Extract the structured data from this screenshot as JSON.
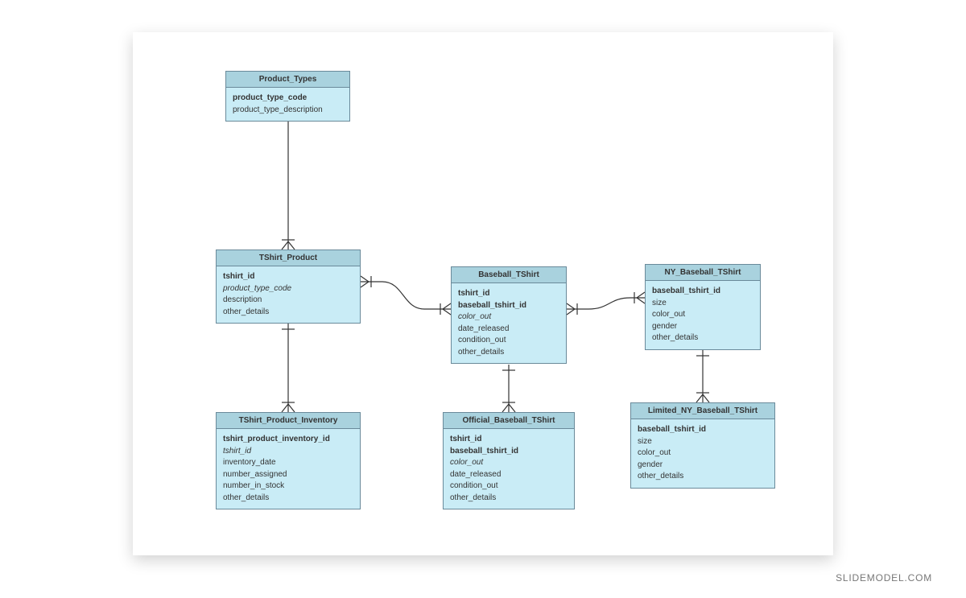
{
  "footer": "SLIDEMODEL.COM",
  "entities": {
    "product_types": {
      "title": "Product_Types",
      "attrs": [
        {
          "text": "product_type_code",
          "style": "bold"
        },
        {
          "text": "product_type_description",
          "style": ""
        }
      ]
    },
    "tshirt_product": {
      "title": "TShirt_Product",
      "attrs": [
        {
          "text": "tshirt_id",
          "style": "bold"
        },
        {
          "text": "product_type_code",
          "style": "italic"
        },
        {
          "text": "description",
          "style": ""
        },
        {
          "text": "other_details",
          "style": ""
        }
      ]
    },
    "tshirt_product_inventory": {
      "title": "TShirt_Product_Inventory",
      "attrs": [
        {
          "text": "tshirt_product_inventory_id",
          "style": "bold"
        },
        {
          "text": "tshirt_id",
          "style": "italic"
        },
        {
          "text": "inventory_date",
          "style": ""
        },
        {
          "text": "number_assigned",
          "style": ""
        },
        {
          "text": "number_in_stock",
          "style": ""
        },
        {
          "text": "other_details",
          "style": ""
        }
      ]
    },
    "baseball_tshirt": {
      "title": "Baseball_TShirt",
      "attrs": [
        {
          "text": "tshirt_id",
          "style": "bold"
        },
        {
          "text": "baseball_tshirt_id",
          "style": "bold"
        },
        {
          "text": "color_out",
          "style": "italic"
        },
        {
          "text": "date_released",
          "style": ""
        },
        {
          "text": "condition_out",
          "style": ""
        },
        {
          "text": "other_details",
          "style": ""
        }
      ]
    },
    "official_baseball_tshirt": {
      "title": "Official_Baseball_TShirt",
      "attrs": [
        {
          "text": "tshirt_id",
          "style": "bold"
        },
        {
          "text": "baseball_tshirt_id",
          "style": "bold"
        },
        {
          "text": "color_out",
          "style": "italic"
        },
        {
          "text": "date_released",
          "style": ""
        },
        {
          "text": "condition_out",
          "style": ""
        },
        {
          "text": "other_details",
          "style": ""
        }
      ]
    },
    "ny_baseball_tshirt": {
      "title": "NY_Baseball_TShirt",
      "attrs": [
        {
          "text": "baseball_tshirt_id",
          "style": "bold"
        },
        {
          "text": "size",
          "style": ""
        },
        {
          "text": "color_out",
          "style": ""
        },
        {
          "text": "gender",
          "style": ""
        },
        {
          "text": "other_details",
          "style": ""
        }
      ]
    },
    "limited_ny_baseball_tshirt": {
      "title": "Limited_NY_Baseball_TShirt",
      "attrs": [
        {
          "text": "baseball_tshirt_id",
          "style": "bold"
        },
        {
          "text": "size",
          "style": ""
        },
        {
          "text": "color_out",
          "style": ""
        },
        {
          "text": "gender",
          "style": ""
        },
        {
          "text": "other_details",
          "style": ""
        }
      ]
    }
  }
}
